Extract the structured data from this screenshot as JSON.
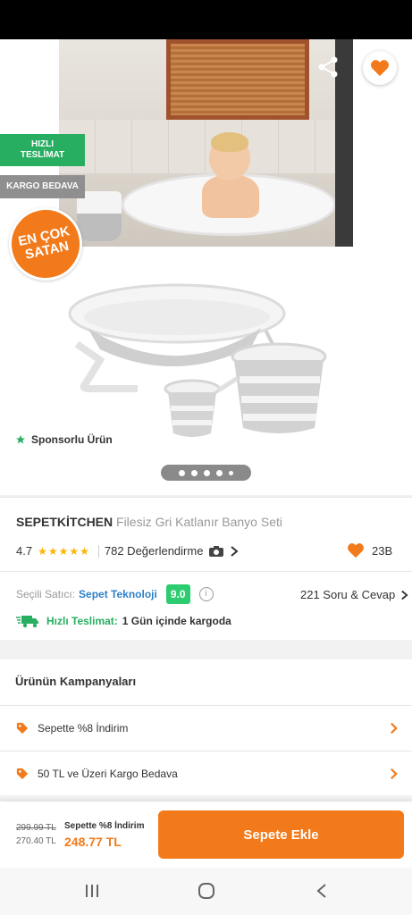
{
  "hero": {
    "tag_fast": "HIZLI\nTESLİMAT",
    "tag_cargo": "KARGO BEDAVA",
    "best_badge": "EN ÇOK\nSATAN",
    "sponsored": "Sponsorlu Ürün",
    "carousel": {
      "total": 5,
      "active": 1
    }
  },
  "product": {
    "brand": "SEPETKİTCHEN",
    "name": "Filesiz Gri Katlanır Banyo Seti",
    "rating": "4.7",
    "stars": "★★★★★",
    "reviews": "782 Değerlendirme",
    "likes": "23B"
  },
  "seller": {
    "label": "Seçili Satıcı:",
    "name": "Sepet Teknoloji",
    "score": "9.0",
    "qa": "221 Soru & Cevap"
  },
  "delivery": {
    "label": "Hızlı Teslimat:",
    "value": "1 Gün içinde kargoda"
  },
  "campaigns": {
    "title": "Ürünün Kampanyaları",
    "items": [
      {
        "label": "Sepette %8 İndirim"
      },
      {
        "label": "50 TL ve Üzeri Kargo Bedava"
      }
    ]
  },
  "checkout": {
    "price_old": "299.99 TL",
    "price_mid": "270.40 TL",
    "promo_label": "Sepette %8 İndirim",
    "price_final": "248.77 TL",
    "add_button": "Sepete Ekle"
  },
  "colors": {
    "accent": "#f27a1a",
    "green": "#27ae60",
    "seller_blue": "#2f80c9"
  }
}
